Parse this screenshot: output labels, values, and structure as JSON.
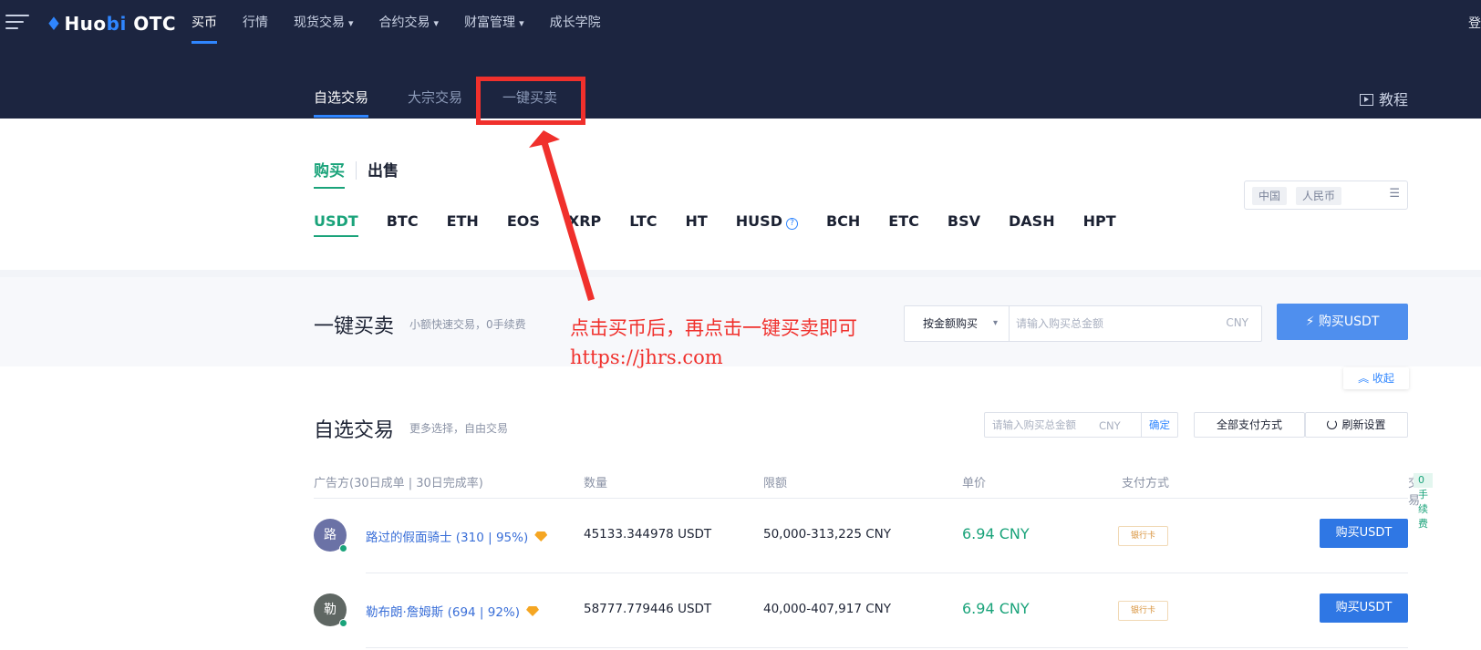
{
  "header": {
    "logo_text_a": "Huo",
    "logo_text_b": "bi",
    "logo_text_c": " OTC",
    "nav": [
      {
        "label": "买币"
      },
      {
        "label": "行情"
      },
      {
        "label": "现货交易"
      },
      {
        "label": "合约交易"
      },
      {
        "label": "财富管理"
      },
      {
        "label": "成长学院"
      }
    ],
    "login_label": "登"
  },
  "subnav": {
    "tabs": [
      "自选交易",
      "大宗交易",
      "一键买卖"
    ],
    "tutorial_label": "教程"
  },
  "trade_mode": {
    "buy_label": "购买",
    "sell_label": "出售"
  },
  "coins": [
    "USDT",
    "BTC",
    "ETH",
    "EOS",
    "XRP",
    "LTC",
    "HT",
    "HUSD",
    "BCH",
    "ETC",
    "BSV",
    "DASH",
    "HPT"
  ],
  "region": {
    "country": "中国",
    "currency": "人民币"
  },
  "quick": {
    "title": "一键买卖",
    "subtitle": "小额快速交易，0手续费",
    "mode_label": "按金额购买",
    "amount_placeholder": "请输入购买总金额",
    "unit": "CNY",
    "buy_button": "购买USDT",
    "collapse_label": "收起"
  },
  "annotation": {
    "line1": "点击买币后，再点击一键买卖即可",
    "line2": "https://jhrs.com"
  },
  "custom": {
    "title": "自选交易",
    "subtitle": "更多选择，自由交易",
    "amount_placeholder": "请输入购买总金额",
    "unit": "CNY",
    "confirm_label": "确定",
    "payment_filter": "全部支付方式",
    "refresh_label": "刷新设置"
  },
  "table": {
    "headers": {
      "merchant": "广告方(30日成单 | 30日完成率)",
      "quantity": "数量",
      "limit": "限额",
      "price": "单价",
      "payment": "支付方式",
      "trade": "交易",
      "fee_badge": "0 手续费"
    },
    "rows": [
      {
        "avatar": "路",
        "merchant": "路过的假面骑士 (310 | 95%)",
        "quantity": "45133.344978 USDT",
        "limit": "50,000-313,225 CNY",
        "price": "6.94 CNY",
        "payment": "银行卡",
        "action": "购买USDT",
        "avatar_color": "#6b72a6"
      },
      {
        "avatar": "勒",
        "merchant": "勒布朗·詹姆斯 (694 | 92%)",
        "quantity": "58777.779446 USDT",
        "limit": "40,000-407,917 CNY",
        "price": "6.94 CNY",
        "payment": "银行卡",
        "action": "购买USDT",
        "avatar_color": "#5f6763"
      }
    ]
  },
  "colors": {
    "header_bg": "#1c2540",
    "accent_blue": "#2f86ff",
    "accent_green": "#1aa37a",
    "annotation_red": "#f0302c"
  }
}
